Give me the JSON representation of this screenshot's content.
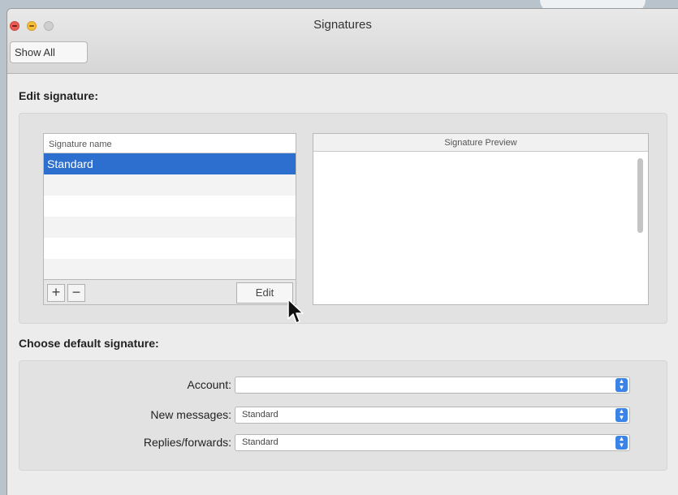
{
  "window": {
    "title": "Signatures"
  },
  "toolbar": {
    "show_all_label": "Show All"
  },
  "edit_section": {
    "title": "Edit signature:",
    "list_header": "Signature name",
    "rows": [
      "Standard",
      "",
      "",
      "",
      "",
      ""
    ],
    "add_label": "+",
    "remove_label": "−",
    "edit_label": "Edit",
    "preview_header": "Signature Preview"
  },
  "default_section": {
    "title": "Choose default signature:",
    "fields": [
      {
        "label": "Account:",
        "value": ""
      },
      {
        "label": "New messages:",
        "value": "Standard"
      },
      {
        "label": "Replies/forwards:",
        "value": "Standard"
      }
    ]
  },
  "icons": {
    "close": "close-icon",
    "minimize": "minimize-icon",
    "zoom": "zoom-icon",
    "popup_arrow": "updown-chevron-icon",
    "cursor": "mouse-pointer-icon"
  },
  "colors": {
    "selection": "#2d6fce",
    "popup_accent": "#3b83e6"
  }
}
